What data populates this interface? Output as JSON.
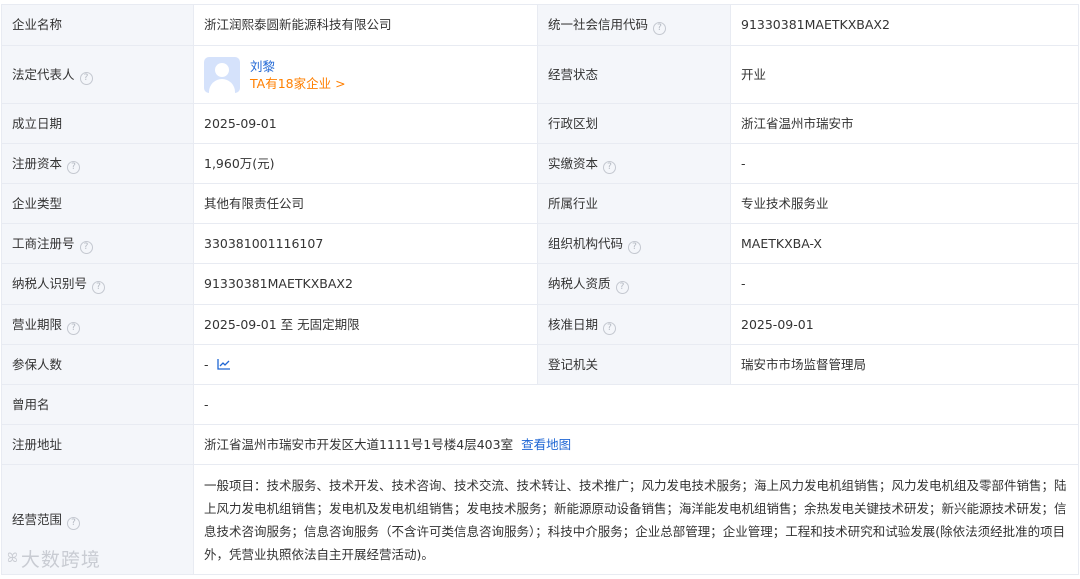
{
  "help_icon": "?",
  "rows": {
    "name": {
      "label": "企业名称",
      "value": "浙江润熙泰圆新能源科技有限公司",
      "label2": "统一社会信用代码",
      "value2": "91330381MAETKXBAX2"
    },
    "legal": {
      "label": "法定代表人",
      "person_name": "刘黎",
      "person_companies": "TA有18家企业 >",
      "label2": "经营状态",
      "value2": "开业"
    },
    "founded": {
      "label": "成立日期",
      "value": "2025-09-01",
      "label2": "行政区划",
      "value2": "浙江省温州市瑞安市"
    },
    "capital": {
      "label": "注册资本",
      "value": "1,960万(元)",
      "label2": "实缴资本",
      "value2": "-"
    },
    "type": {
      "label": "企业类型",
      "value": "其他有限责任公司",
      "label2": "所属行业",
      "value2": "专业技术服务业"
    },
    "reg_no": {
      "label": "工商注册号",
      "value": "330381001116107",
      "label2": "组织机构代码",
      "value2": "MAETKXBA-X"
    },
    "taxpayer": {
      "label": "纳税人识别号",
      "value": "91330381MAETKXBAX2",
      "label2": "纳税人资质",
      "value2": "-"
    },
    "term": {
      "label": "营业期限",
      "value": "2025-09-01 至 无固定期限",
      "label2": "核准日期",
      "value2": "2025-09-01"
    },
    "insured": {
      "label": "参保人数",
      "value": "-",
      "label2": "登记机关",
      "value2": "瑞安市市场监督管理局"
    },
    "former_name": {
      "label": "曾用名",
      "value": "-"
    },
    "address": {
      "label": "注册地址",
      "value": "浙江省温州市瑞安市开发区大道1111号1号楼4层403室",
      "map_link": "查看地图"
    },
    "scope": {
      "label": "经营范围",
      "value": "一般项目：技术服务、技术开发、技术咨询、技术交流、技术转让、技术推广；风力发电技术服务；海上风力发电机组销售；风力发电机组及零部件销售；陆上风力发电机组销售；发电机及发电机组销售；发电技术服务；新能源原动设备销售；海洋能发电机组销售；余热发电关键技术研发；新兴能源技术研发；信息技术咨询服务；信息咨询服务（不含许可类信息咨询服务）；科技中介服务；企业总部管理；企业管理；工程和技术研究和试验发展(除依法须经批准的项目外，凭营业执照依法自主开展经营活动)。"
    }
  },
  "watermark": "大数跨境",
  "colors": {
    "link": "#1f66d4",
    "orange": "#ff7f00",
    "label_bg": "#f4f6fa",
    "border": "#e8ebf2"
  }
}
